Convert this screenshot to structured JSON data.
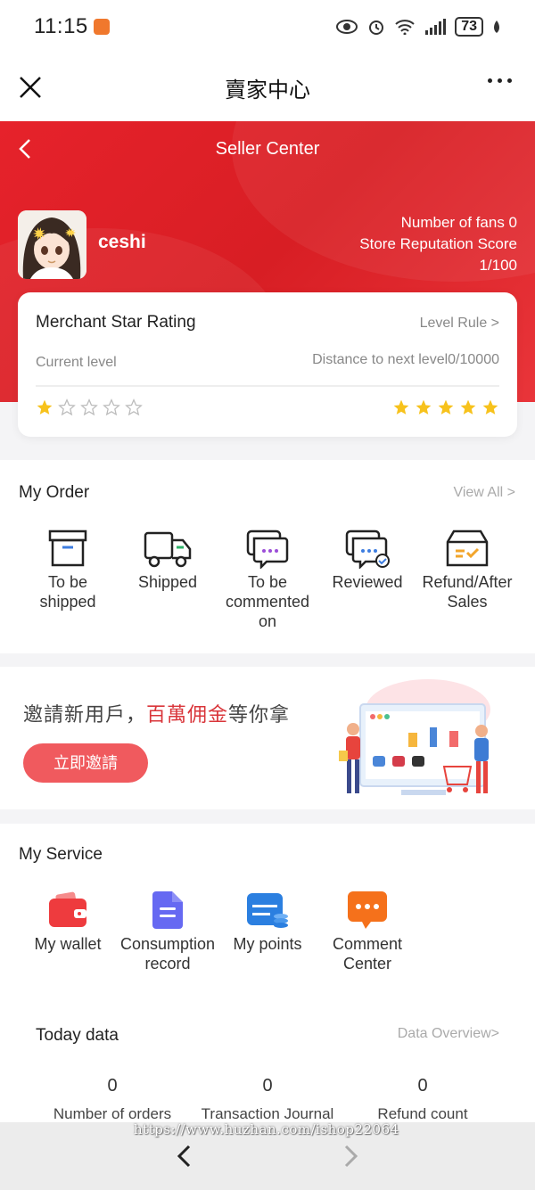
{
  "status": {
    "time": "11:15",
    "battery": "73"
  },
  "titlebar": {
    "title": "賣家中心"
  },
  "header": {
    "title": "Seller Center",
    "username": "ceshi",
    "fans": "Number of fans 0",
    "reputation_label": "Store Reputation Score",
    "reputation_value": "1/100"
  },
  "rating": {
    "title": "Merchant Star Rating",
    "rule_link": "Level Rule >",
    "current_level": "Current level",
    "distance": "Distance to next level0/10000",
    "current_stars": 1,
    "max_stars": 5,
    "next_stars": 5
  },
  "orders": {
    "title": "My Order",
    "view_all": "View All >",
    "items": [
      {
        "label": "To be shipped",
        "icon": "box-icon"
      },
      {
        "label": "Shipped",
        "icon": "truck-icon"
      },
      {
        "label": "To be commented on",
        "icon": "chat-icon"
      },
      {
        "label": "Reviewed",
        "icon": "reviewed-chat-icon"
      },
      {
        "label": "Refund/After Sales",
        "icon": "refund-box-icon"
      }
    ]
  },
  "banner": {
    "text_pre": "邀請新用戶，",
    "text_highlight": "百萬佣金",
    "text_post": "等你拿",
    "button": "立即邀請"
  },
  "service": {
    "title": "My Service",
    "items": [
      {
        "label": "My wallet",
        "icon": "wallet-icon"
      },
      {
        "label": "Consumption record",
        "icon": "record-icon"
      },
      {
        "label": "My points",
        "icon": "points-icon"
      },
      {
        "label": "Comment Center",
        "icon": "comment-icon"
      }
    ]
  },
  "today": {
    "title": "Today data",
    "link": "Data Overview>",
    "stats": [
      {
        "value": "0",
        "label": "Number of orders"
      },
      {
        "value": "0",
        "label": "Transaction Journal"
      },
      {
        "value": "0",
        "label": "Refund count"
      }
    ]
  },
  "watermark": "https://www.huzhan.com/ishop22064",
  "colors": {
    "brand_red": "#e6222b",
    "star": "#f7c21c",
    "button": "#f05a5e"
  }
}
